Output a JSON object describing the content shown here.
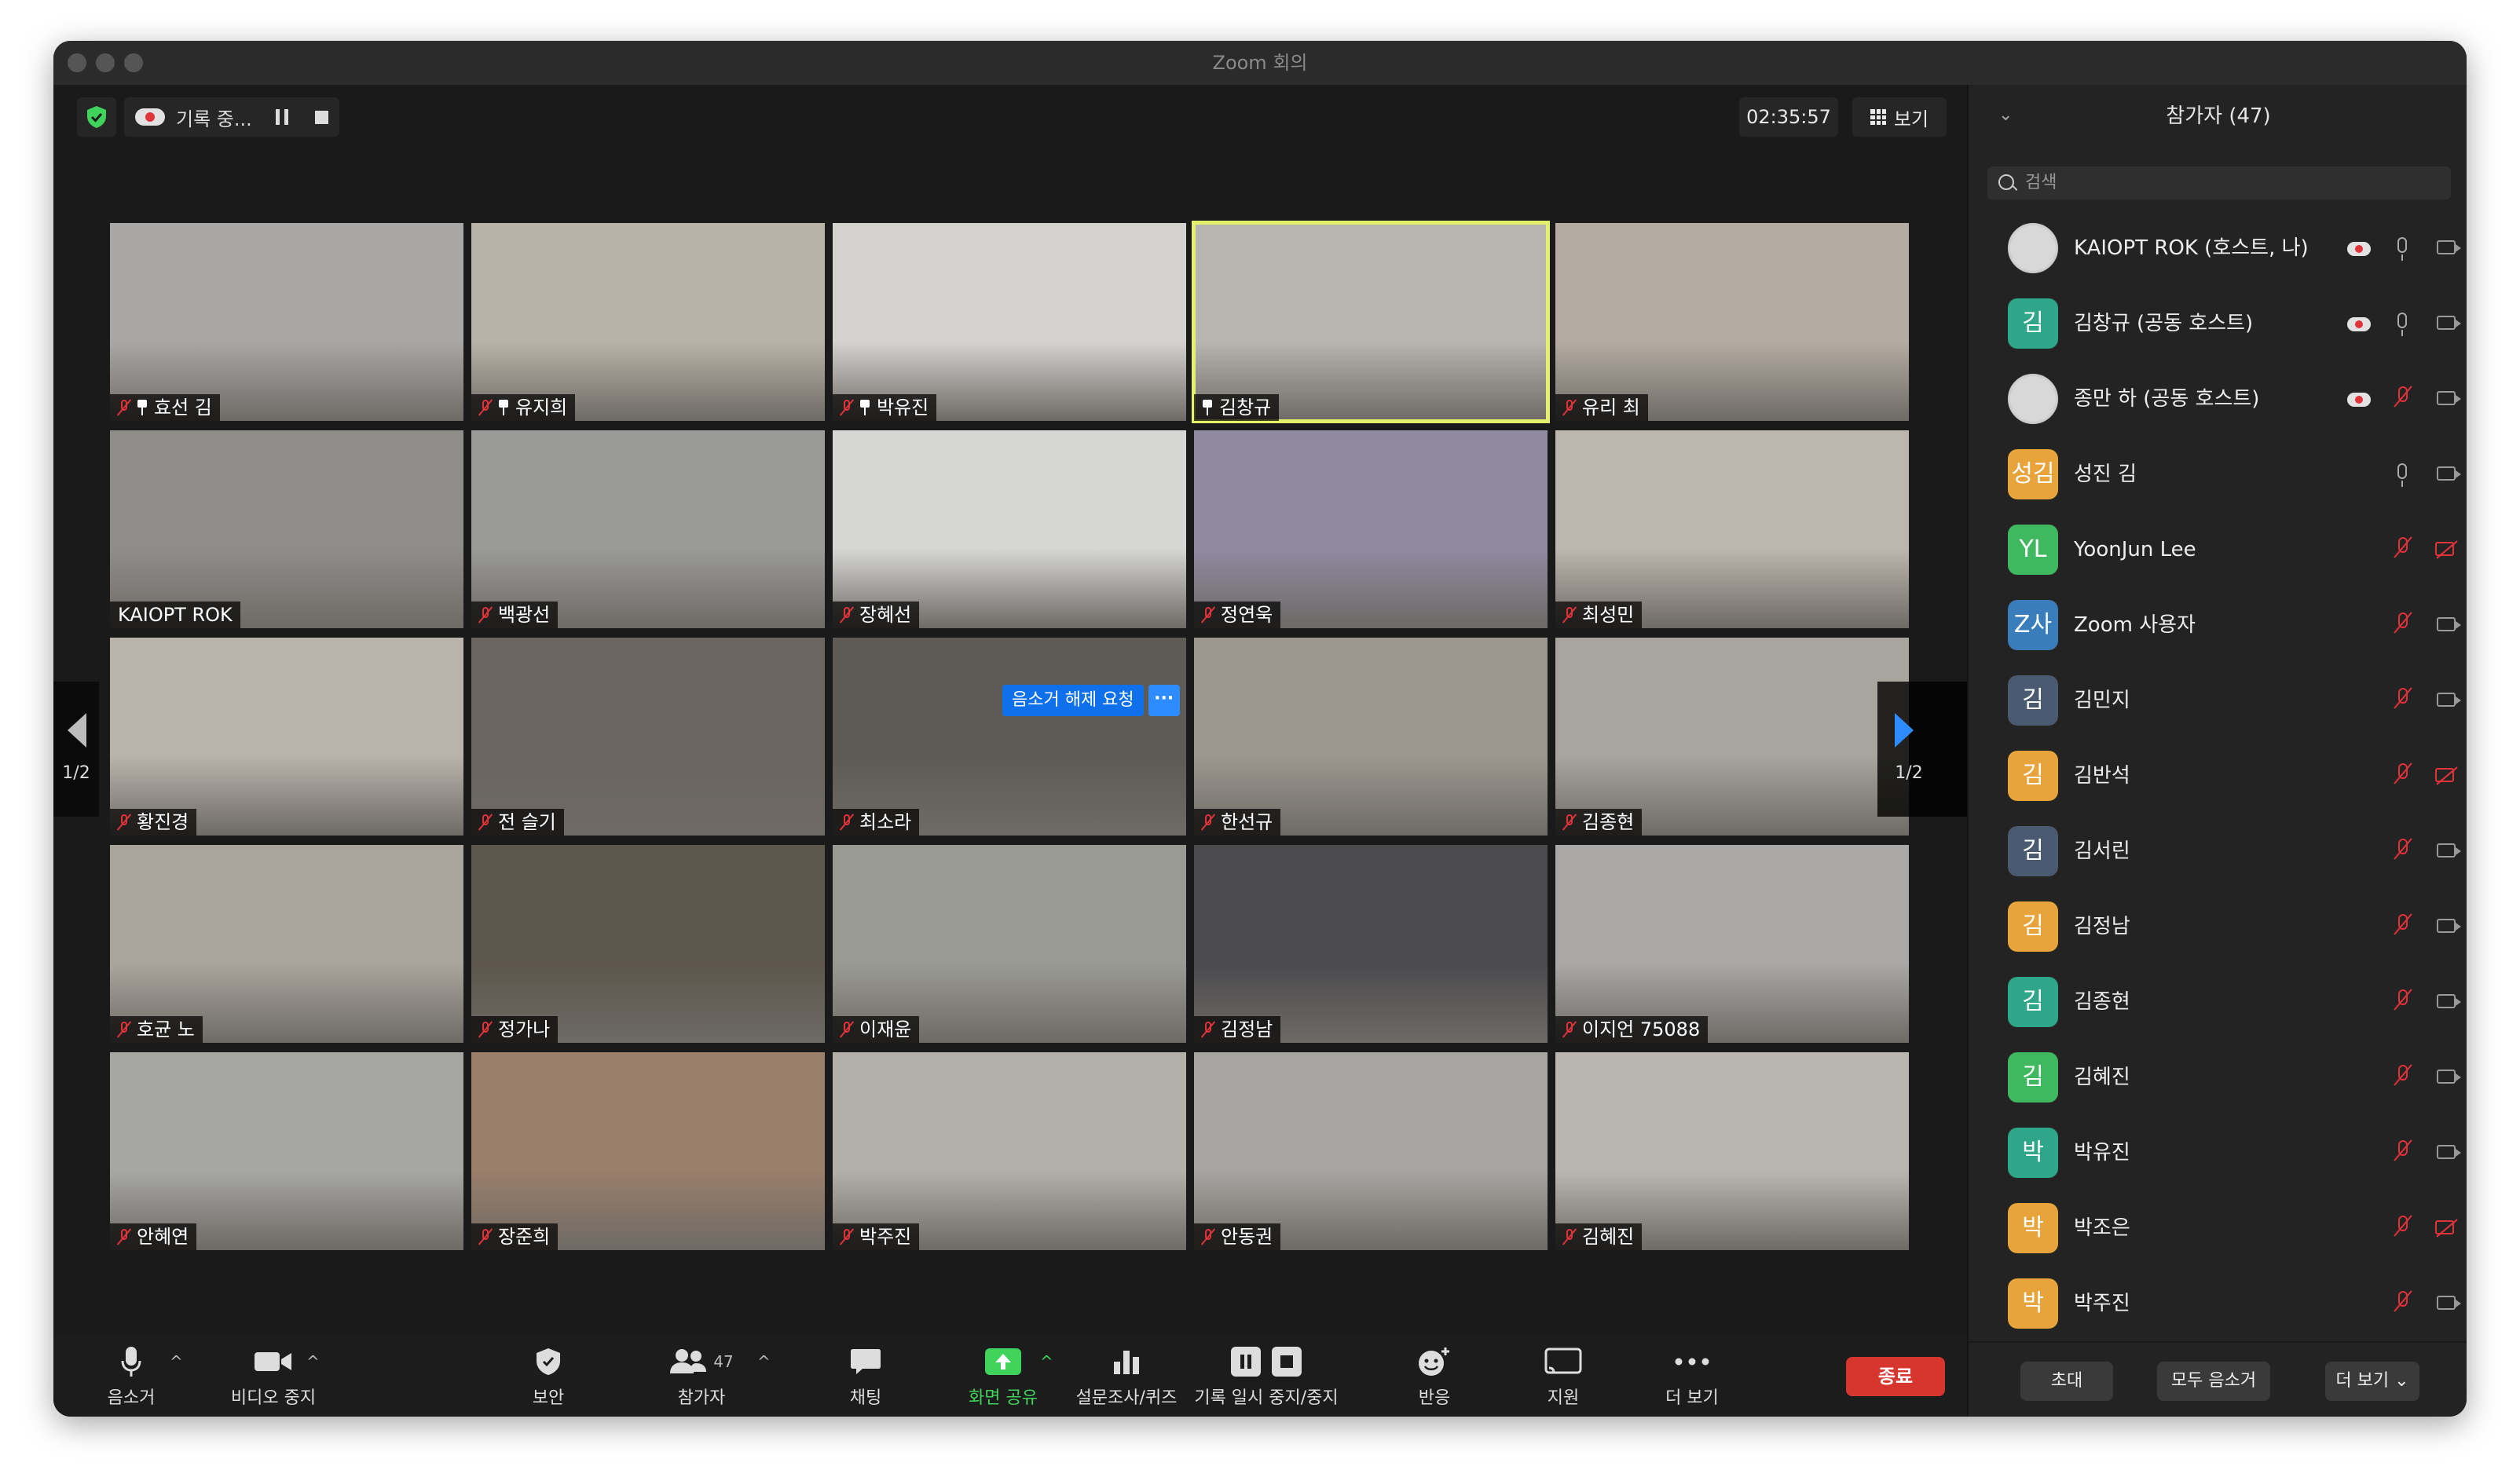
{
  "window": {
    "title": "Zoom 회의"
  },
  "topbar": {
    "recording_label": "기록 중...",
    "elapsed": "02:35:57",
    "view_label": "보기"
  },
  "colors": {
    "active_speaker_border": "#e3f06a",
    "danger": "#d7362e",
    "accent": "#2d8cff",
    "share_green": "#3fd35b"
  },
  "gallery": {
    "page": "1/2",
    "unmute_request_label": "음소거 해제 요청",
    "tiles": [
      {
        "name": "효선 김",
        "muted": true,
        "pinned": true,
        "bg": "#a9a7a5"
      },
      {
        "name": "유지희",
        "muted": true,
        "pinned": true,
        "bg": "#b9b2a6"
      },
      {
        "name": "박유진",
        "muted": true,
        "pinned": true,
        "bg": "#d4d2cf"
      },
      {
        "name": "김창규",
        "muted": false,
        "pinned": true,
        "bg": "#b8b6b0",
        "active": true
      },
      {
        "name": "유리 최",
        "muted": true,
        "pinned": false,
        "bg": "#b4aca2"
      },
      {
        "name": "KAIOPT ROK",
        "muted": false,
        "pinned": false,
        "bg": "#8f8d8a"
      },
      {
        "name": "백광선",
        "muted": true,
        "pinned": false,
        "bg": "#9a9a98"
      },
      {
        "name": "장혜선",
        "muted": true,
        "pinned": false,
        "bg": "#d6d6d4"
      },
      {
        "name": "정연욱",
        "muted": true,
        "pinned": false,
        "bg": "#8f8aa0"
      },
      {
        "name": "최성민",
        "muted": true,
        "pinned": false,
        "bg": "#bdb6ae"
      },
      {
        "name": "황진경",
        "muted": true,
        "pinned": false,
        "bg": "#b9b3ab"
      },
      {
        "name": "전 슬기",
        "muted": true,
        "pinned": false,
        "bg": "#6b6560"
      },
      {
        "name": "최소라",
        "muted": true,
        "pinned": false,
        "bg": "#5e5a55"
      },
      {
        "name": "한선규",
        "muted": true,
        "pinned": false,
        "bg": "#9c978f"
      },
      {
        "name": "김종현",
        "muted": true,
        "pinned": false,
        "bg": "#a8a49e"
      },
      {
        "name": "호균 노",
        "muted": true,
        "pinned": false,
        "bg": "#a9a49c"
      },
      {
        "name": "정가나",
        "muted": true,
        "pinned": false,
        "bg": "#5d564b"
      },
      {
        "name": "이재윤",
        "muted": true,
        "pinned": false,
        "bg": "#9a9a94"
      },
      {
        "name": "김정남",
        "muted": true,
        "pinned": false,
        "bg": "#4b4a4d"
      },
      {
        "name": "이지언 75088",
        "muted": true,
        "pinned": false,
        "bg": "#a9a8a6"
      },
      {
        "name": "안혜연",
        "muted": true,
        "pinned": false,
        "bg": "#a6a6a2"
      },
      {
        "name": "장준희",
        "muted": true,
        "pinned": false,
        "bg": "#9a7f6a"
      },
      {
        "name": "박주진",
        "muted": true,
        "pinned": false,
        "bg": "#b3b0aa"
      },
      {
        "name": "안동권",
        "muted": true,
        "pinned": false,
        "bg": "#a7a5a1"
      },
      {
        "name": "김혜진",
        "muted": true,
        "pinned": false,
        "bg": "#b9b6b1"
      }
    ]
  },
  "toolbar": {
    "mute": "음소거",
    "video_stop": "비디오 중지",
    "security": "보안",
    "participants": "참가자",
    "participants_count": "47",
    "chat": "채팅",
    "share_screen": "화면 공유",
    "polls": "설문조사/퀴즈",
    "record": "기록 일시 중지/중지",
    "reactions": "반응",
    "support": "지원",
    "more": "더 보기",
    "end": "종료"
  },
  "panel": {
    "title": "참가자 (47)",
    "search_placeholder": "검색",
    "invite": "초대",
    "mute_all": "모두 음소거",
    "more": "더 보기",
    "participants": [
      {
        "avatar": "",
        "name": "KAIOPT ROK (호스트, 나)",
        "color": "#d8d8d8",
        "recording": true,
        "mic": "on",
        "cam": "on"
      },
      {
        "avatar": "김",
        "name": "김창규 (공동 호스트)",
        "color": "#2fa58a",
        "recording": true,
        "mic": "on",
        "cam": "on"
      },
      {
        "avatar": "",
        "name": "종만 하 (공동 호스트)",
        "color": "#d8d8d8",
        "recording": true,
        "mic": "off",
        "cam": "on"
      },
      {
        "avatar": "성김",
        "name": "성진 김",
        "color": "#e8a33a",
        "recording": false,
        "mic": "on",
        "cam": "on"
      },
      {
        "avatar": "YL",
        "name": "YoonJun Lee",
        "color": "#3fb860",
        "recording": false,
        "mic": "off",
        "cam": "off"
      },
      {
        "avatar": "Z사",
        "name": "Zoom 사용자",
        "color": "#3a7dbd",
        "recording": false,
        "mic": "off",
        "cam": "on"
      },
      {
        "avatar": "김",
        "name": "김민지",
        "color": "#4a5a70",
        "recording": false,
        "mic": "off",
        "cam": "on"
      },
      {
        "avatar": "김",
        "name": "김반석",
        "color": "#e8a33a",
        "recording": false,
        "mic": "off",
        "cam": "off"
      },
      {
        "avatar": "김",
        "name": "김서린",
        "color": "#4a5a70",
        "recording": false,
        "mic": "off",
        "cam": "on"
      },
      {
        "avatar": "김",
        "name": "김정남",
        "color": "#e8a33a",
        "recording": false,
        "mic": "off",
        "cam": "on"
      },
      {
        "avatar": "김",
        "name": "김종현",
        "color": "#2fa58a",
        "recording": false,
        "mic": "off",
        "cam": "on"
      },
      {
        "avatar": "김",
        "name": "김혜진",
        "color": "#3fb860",
        "recording": false,
        "mic": "off",
        "cam": "on"
      },
      {
        "avatar": "박",
        "name": "박유진",
        "color": "#2fa58a",
        "recording": false,
        "mic": "off",
        "cam": "on"
      },
      {
        "avatar": "박",
        "name": "박조은",
        "color": "#e8a33a",
        "recording": false,
        "mic": "off",
        "cam": "off"
      },
      {
        "avatar": "박",
        "name": "박주진",
        "color": "#e8a33a",
        "recording": false,
        "mic": "off",
        "cam": "on"
      }
    ]
  }
}
